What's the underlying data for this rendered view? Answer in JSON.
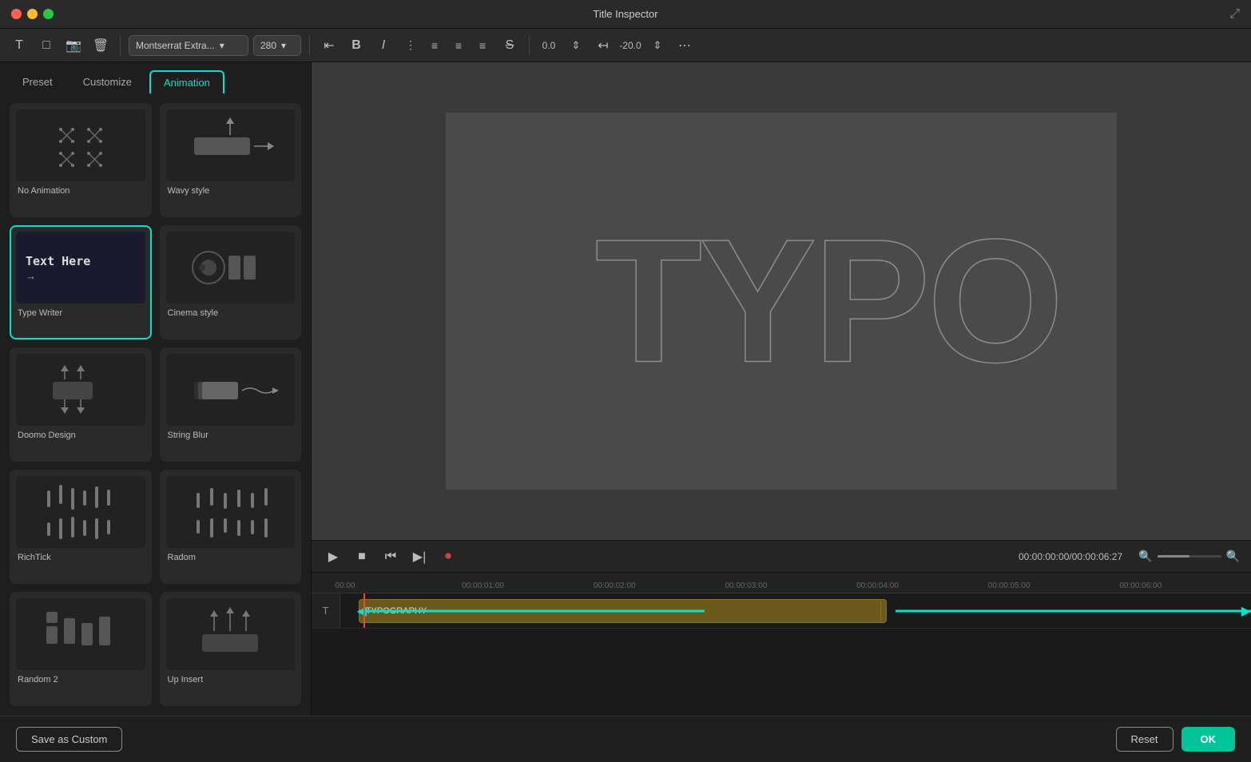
{
  "titleBar": {
    "title": "Title Inspector",
    "controls": [
      "red",
      "yellow",
      "green"
    ]
  },
  "toolbar": {
    "font": "Montserrat Extra...",
    "fontSize": "280",
    "textAlignLeft": "align-left",
    "textAlignCenter": "align-center",
    "textAlignRight": "align-right",
    "textAlignJustify": "align-justify",
    "strikethrough": "strikethrough",
    "tracking": "0.0",
    "lineSpacing": "-20.0"
  },
  "tabs": [
    {
      "id": "preset",
      "label": "Preset"
    },
    {
      "id": "customize",
      "label": "Customize"
    },
    {
      "id": "animation",
      "label": "Animation",
      "active": true
    }
  ],
  "animations": [
    {
      "id": "no-animation",
      "label": "No Animation",
      "selected": false
    },
    {
      "id": "wavy-style",
      "label": "Wavy style",
      "selected": false
    },
    {
      "id": "type-writer",
      "label": "Type Writer",
      "selected": true
    },
    {
      "id": "cinema-style",
      "label": "Cinema style",
      "selected": false
    },
    {
      "id": "doomo-design",
      "label": "Doomo Design",
      "selected": false
    },
    {
      "id": "string-blur",
      "label": "String Blur",
      "selected": false
    },
    {
      "id": "richtick",
      "label": "RichTick",
      "selected": false
    },
    {
      "id": "radom",
      "label": "Radom",
      "selected": false
    },
    {
      "id": "random2",
      "label": "Random 2",
      "selected": false
    },
    {
      "id": "up-insert",
      "label": "Up Insert",
      "selected": false
    }
  ],
  "preview": {
    "text": "TYPO",
    "canvasText": "TYPOGRAPHY"
  },
  "timeline": {
    "currentTime": "00:00:00:00",
    "totalTime": "00:00:06:27",
    "playheadPosition": "0%",
    "rulerMarks": [
      {
        "label": "00:00",
        "pos": "2%"
      },
      {
        "label": "00:00:01:00",
        "pos": "16%"
      },
      {
        "label": "00:00:02:00",
        "pos": "30%"
      },
      {
        "label": "00:00:03:00",
        "pos": "44%"
      },
      {
        "label": "00:00:04:00",
        "pos": "58%"
      },
      {
        "label": "00:00:05:00",
        "pos": "72%"
      },
      {
        "label": "00:00:06:00",
        "pos": "86%"
      }
    ],
    "trackLabel": "T",
    "clipLabel": "TYPOGRAPHY",
    "clipStart": "2%",
    "clipWidth": "59%",
    "clipDividerPos": "61%",
    "playheadLeft": "2%"
  },
  "bottomBar": {
    "saveLabel": "Save as Custom",
    "resetLabel": "Reset",
    "okLabel": "OK"
  }
}
